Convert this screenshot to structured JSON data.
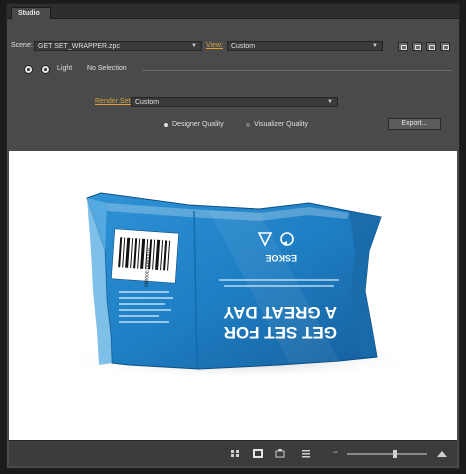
{
  "panel": {
    "tab_label": "Studio"
  },
  "scene_row": {
    "scene_label": "Scene:",
    "scene_value": "GET SET_WRAPPER.zpc",
    "view_label": "View:",
    "view_value": "Custom"
  },
  "light_row": {
    "light_label": "Light",
    "light_value": "No Selection"
  },
  "render_row": {
    "render_settings_label": "Render Settings:",
    "render_settings_value": "Custom"
  },
  "quality_row": {
    "designer_quality": "Designer Quality",
    "visualizer_quality": "Visualizer Quality",
    "export_label": "Export..."
  },
  "product": {
    "headline_line1": "GET SET FOR",
    "headline_line2": "A GREAT DAY",
    "brand_code": "ESKOE",
    "barcode_number": "5 000000 000000"
  },
  "zoom": {
    "level": 0.6
  },
  "colors": {
    "accent_orange": "#d9a13c",
    "wrapper_blue": "#1f7fc4",
    "wrapper_dark": "#155f9c"
  }
}
